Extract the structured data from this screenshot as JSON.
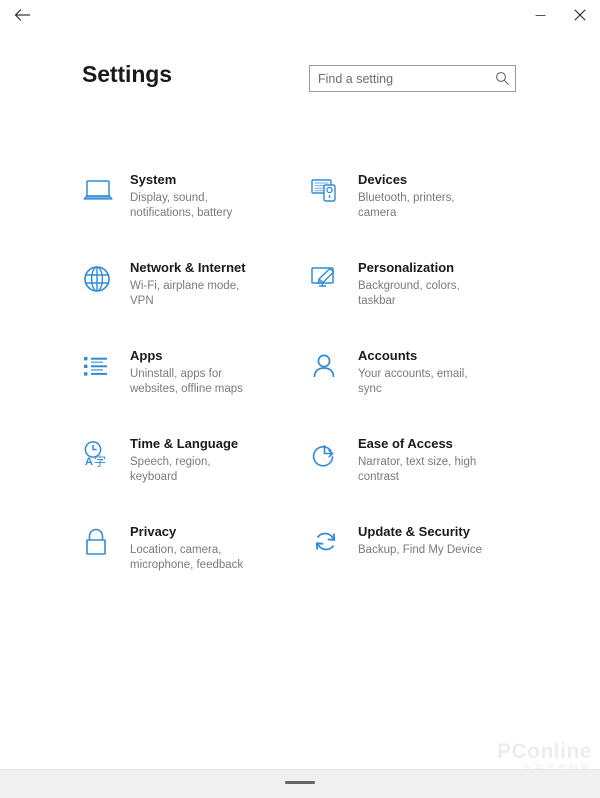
{
  "window": {
    "back_label": "Back",
    "minimize_label": "Minimize",
    "close_label": "Close"
  },
  "header": {
    "title": "Settings",
    "search_placeholder": "Find a setting",
    "search_value": "",
    "search_icon": "search-icon"
  },
  "tiles": [
    {
      "id": "system",
      "icon": "laptop-icon",
      "title": "System",
      "desc": "Display, sound, notifications, battery"
    },
    {
      "id": "devices",
      "icon": "keyboard-mouse-icon",
      "title": "Devices",
      "desc": "Bluetooth, printers, camera"
    },
    {
      "id": "network",
      "icon": "globe-icon",
      "title": "Network & Internet",
      "desc": "Wi-Fi, airplane mode, VPN"
    },
    {
      "id": "personalization",
      "icon": "monitor-brush-icon",
      "title": "Personalization",
      "desc": "Background, colors, taskbar"
    },
    {
      "id": "apps",
      "icon": "list-icon",
      "title": "Apps",
      "desc": "Uninstall, apps for websites, offline maps"
    },
    {
      "id": "accounts",
      "icon": "person-icon",
      "title": "Accounts",
      "desc": "Your accounts, email, sync"
    },
    {
      "id": "time-language",
      "icon": "clock-language-icon",
      "title": "Time & Language",
      "desc": "Speech, region, keyboard"
    },
    {
      "id": "ease-of-access",
      "icon": "accessibility-icon",
      "title": "Ease of Access",
      "desc": "Narrator, text size, high contrast"
    },
    {
      "id": "privacy",
      "icon": "lock-icon",
      "title": "Privacy",
      "desc": "Location, camera, microphone, feedback"
    },
    {
      "id": "update-security",
      "icon": "sync-refresh-icon",
      "title": "Update & Security",
      "desc": "Backup, Find My Device"
    }
  ],
  "watermark": {
    "main": "PConline",
    "sub": "太平洋电脑网"
  },
  "colors": {
    "accent": "#2E8BD8",
    "title_text": "#1a1a1a",
    "desc_text": "#7a7a7a",
    "bottom_bar": "#f0f0f0"
  }
}
